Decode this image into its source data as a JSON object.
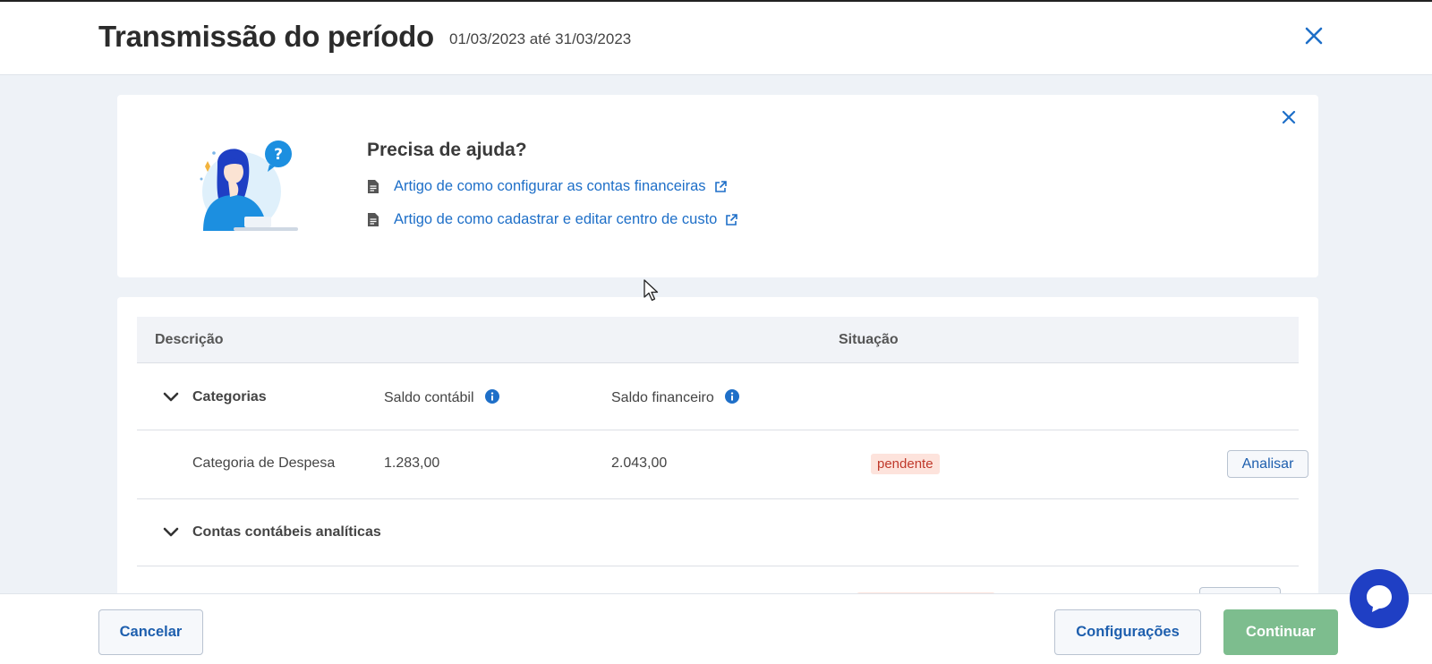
{
  "header": {
    "title": "Transmissão do período",
    "period": "01/03/2023 até 31/03/2023"
  },
  "help": {
    "title": "Precisa de ajuda?",
    "links": [
      {
        "label": "Artigo de como configurar as contas financeiras"
      },
      {
        "label": "Artigo de como cadastrar e editar centro de custo"
      }
    ]
  },
  "table": {
    "columns": {
      "descricao": "Descrição",
      "situacao": "Situação"
    },
    "groups": [
      {
        "label": "Categorias",
        "col_saldo_contabil": "Saldo contábil",
        "col_saldo_financeiro": "Saldo financeiro",
        "rows": [
          {
            "descricao": "Categoria de Despesa",
            "saldo_contabil": "1.283,00",
            "saldo_financeiro": "2.043,00",
            "situacao": "pendente",
            "action": "Analisar"
          }
        ]
      },
      {
        "label": "Contas contábeis analíticas"
      }
    ]
  },
  "footer": {
    "cancel": "Cancelar",
    "config": "Configurações",
    "continue": "Continuar"
  },
  "colors": {
    "link": "#1e6fc8",
    "primary_button": "#7dbd8e",
    "badge_bg": "#fde3dc",
    "badge_text": "#c0392b",
    "chat": "#1f3fc4"
  }
}
